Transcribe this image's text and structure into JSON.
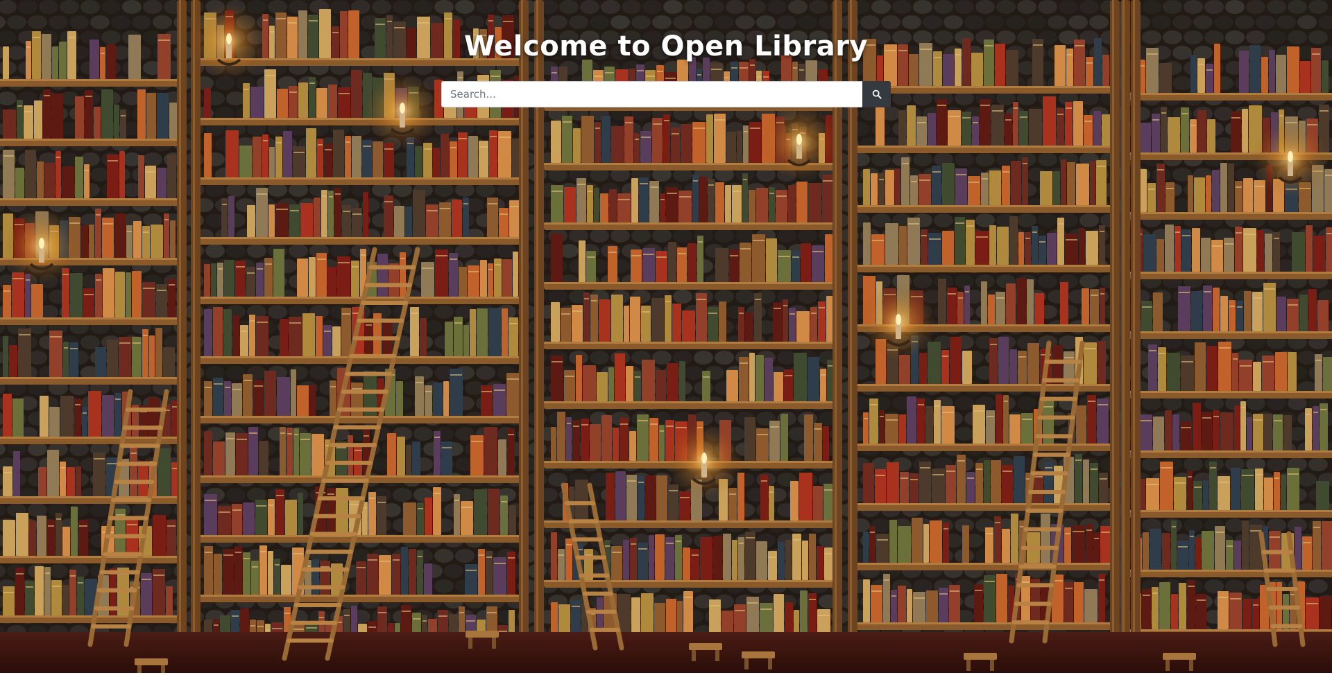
{
  "page": {
    "title": "Welcome to Open Library"
  },
  "search": {
    "placeholder": "Search...",
    "value": "",
    "button_icon": "search-icon"
  },
  "colors": {
    "title_text": "#ffffff",
    "button_background": "#343a40",
    "input_background": "#ffffff"
  },
  "background": {
    "description_icon": "library-bookshelves-illustration"
  }
}
